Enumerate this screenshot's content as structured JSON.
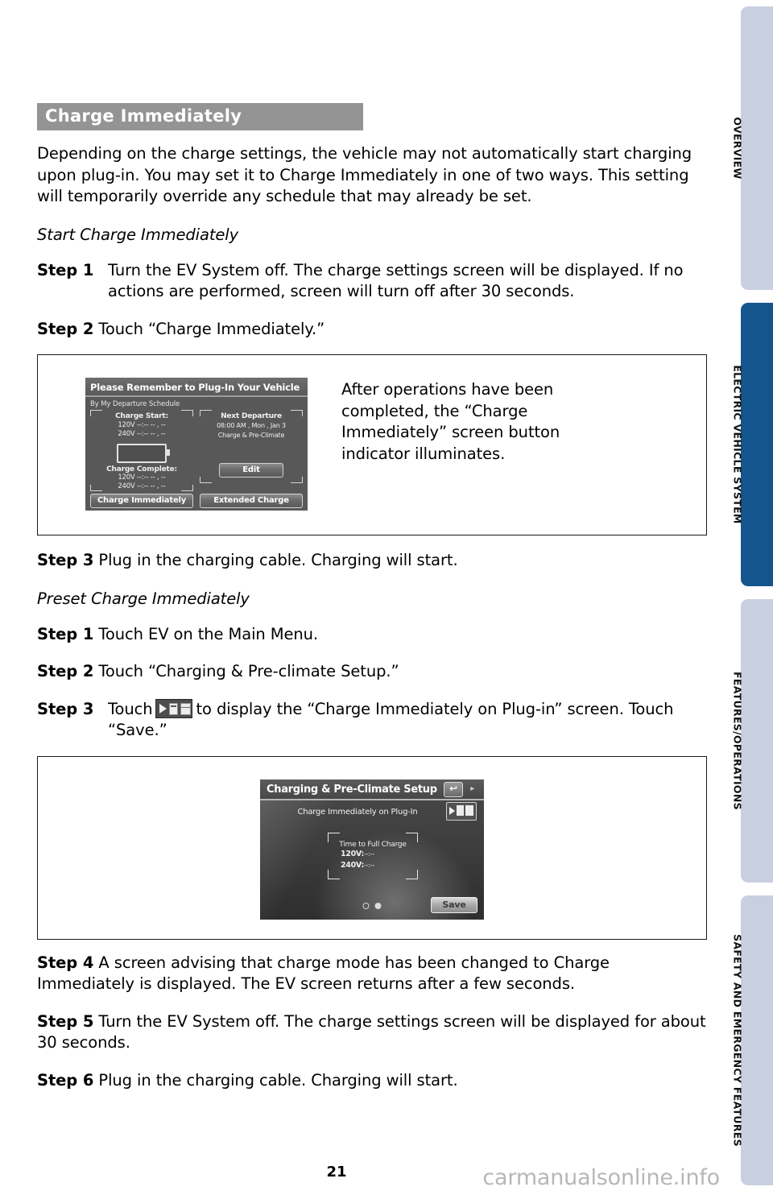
{
  "section": {
    "title": "Charge Immediately"
  },
  "intro": "Depending on the charge settings, the vehicle may not automatically start charging upon plug-in. You may set it to Charge Immediately in one of two ways. This setting will temporarily override any schedule that may already be set.",
  "subhead_1": "Start Charge Immediately",
  "subhead_2": "Preset Charge Immediately",
  "steps_start": [
    {
      "label": "Step 1",
      "text": "Turn the EV System off. The charge settings screen will be displayed. If no actions are performed, screen will turn off after 30 seconds."
    },
    {
      "label": "Step 2",
      "text": "Touch “Charge Immediately.”"
    },
    {
      "label": "Step 3",
      "text": "Plug in the charging cable. Charging will start."
    }
  ],
  "steps_preset": [
    {
      "label": "Step 1",
      "text": "Touch EV on the Main Menu."
    },
    {
      "label": "Step 2",
      "text": "Touch “Charging & Pre-climate Setup.”"
    },
    {
      "label": "Step 3",
      "text_before": "Touch",
      "text_after": "to display the “Charge Immediately on Plug-in” screen. Touch “Save.”"
    },
    {
      "label": "Step 4",
      "text": "A screen advising that charge mode has been changed to Charge Immediately is displayed. The EV screen returns after a few seconds."
    },
    {
      "label": "Step 5",
      "text": "Turn the EV System off. The charge settings screen will be displayed for about 30 seconds."
    },
    {
      "label": "Step 6",
      "text": "Plug in the charging cable. Charging will start."
    }
  ],
  "figure_1": {
    "caption": "After operations have been completed, the “Charge Immediately” screen button indicator illuminates.",
    "screen": {
      "title": "Please Remember to Plug-In Your Vehicle",
      "schedule_label": "By My Departure Schedule",
      "charge_start_label": "Charge Start:",
      "charge_start_120v": "120V --:-- --  ,  --",
      "charge_start_240v": "240V --:-- --  ,  --",
      "charge_complete_label": "Charge Complete:",
      "charge_complete_120v": "120V --:-- --  ,  --",
      "charge_complete_240v": "240V --:-- --  ,  --",
      "next_departure_label": "Next Departure",
      "next_departure_time": "08:00 AM  , Mon , Jan  3",
      "next_departure_mode": "Charge & Pre-Climate",
      "edit_button": "Edit",
      "charge_immediately_button": "Charge Immediately",
      "extended_charge_button": "Extended Charge"
    }
  },
  "figure_2": {
    "screen": {
      "title": "Charging & Pre-Climate Setup",
      "back_icon": "back-arrow-icon",
      "row_label": "Charge Immediately on Plug-In",
      "mode_icon": "charge-immediately-icon",
      "time_to_full_charge_label": "Time to Full Charge",
      "time_120v_label": "120V:",
      "time_120v_value": "--:--",
      "time_240v_label": "240V:",
      "time_240v_value": "--:--",
      "save_button": "Save"
    }
  },
  "side_tabs": [
    {
      "label": "OVERVIEW",
      "active": false
    },
    {
      "label": "ELECTRIC VEHICLE SYSTEM",
      "active": true
    },
    {
      "label": "FEATURES/OPERATIONS",
      "active": false
    },
    {
      "label": "SAFETY AND EMERGENCY FEATURES",
      "active": false
    }
  ],
  "footer": {
    "page_number": "21",
    "watermark": "carmanualsonline.info"
  },
  "colors": {
    "title_bar": "#949494",
    "tab_active": "#15558d",
    "tab_inactive": "#c8d0e0",
    "watermark": "#b7b7b7"
  }
}
